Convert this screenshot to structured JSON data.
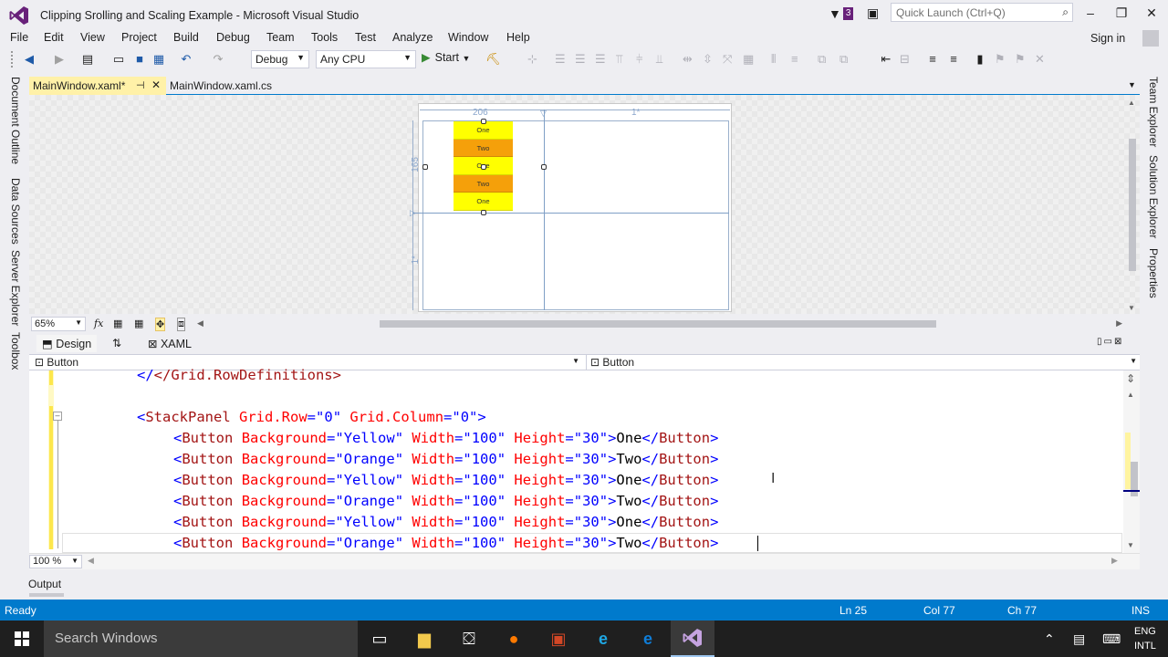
{
  "window": {
    "title": "Clipping Srolling and Scaling Example - Microsoft Visual Studio",
    "notification_count": "3",
    "quick_launch_placeholder": "Quick Launch (Ctrl+Q)"
  },
  "menu": {
    "items": [
      "File",
      "Edit",
      "View",
      "Project",
      "Build",
      "Debug",
      "Team",
      "Tools",
      "Test",
      "Analyze",
      "Window",
      "Help"
    ],
    "sign_in": "Sign in"
  },
  "toolbar": {
    "config": "Debug",
    "platform": "Any CPU",
    "start": "Start"
  },
  "left_tools": [
    "Document Outline",
    "Data Sources",
    "Server Explorer",
    "Toolbox"
  ],
  "right_tools": [
    "Team Explorer",
    "Solution Explorer",
    "Properties"
  ],
  "doc_tabs": {
    "active": "MainWindow.xaml*",
    "inactive": "MainWindow.xaml.cs"
  },
  "designer": {
    "col_width": "206",
    "col_star": "1*",
    "row_height": "165",
    "row_star": "1*",
    "buttons": [
      "One",
      "Two",
      "One",
      "Two",
      "One"
    ],
    "zoom": "65%"
  },
  "split": {
    "design": "Design",
    "xaml": "XAML"
  },
  "nav": {
    "left": "Button",
    "right": "Button"
  },
  "code": {
    "line_prev": "</Grid.RowDefinitions>",
    "stackpanel": {
      "tag": "StackPanel",
      "attrs": [
        [
          "Grid.Row",
          "0"
        ],
        [
          "Grid.Column",
          "0"
        ]
      ]
    },
    "buttons": [
      {
        "bg": "Yellow",
        "w": "100",
        "h": "30",
        "text": "One"
      },
      {
        "bg": "Orange",
        "w": "100",
        "h": "30",
        "text": "Two"
      },
      {
        "bg": "Yellow",
        "w": "100",
        "h": "30",
        "text": "One"
      },
      {
        "bg": "Orange",
        "w": "100",
        "h": "30",
        "text": "Two"
      },
      {
        "bg": "Yellow",
        "w": "100",
        "h": "30",
        "text": "One"
      },
      {
        "bg": "Orange",
        "w": "100",
        "h": "30",
        "text": "Two"
      }
    ],
    "editor_zoom": "100 %"
  },
  "output_tab": "Output",
  "status": {
    "state": "Ready",
    "ln": "Ln 25",
    "col": "Col 77",
    "ch": "Ch 77",
    "mode": "INS"
  },
  "taskbar": {
    "search": "Search Windows",
    "lang_top": "ENG",
    "lang_bottom": "INTL"
  },
  "colors": {
    "accent": "#007acc",
    "vs_purple": "#68217a",
    "active_tab": "#fff1a8"
  }
}
